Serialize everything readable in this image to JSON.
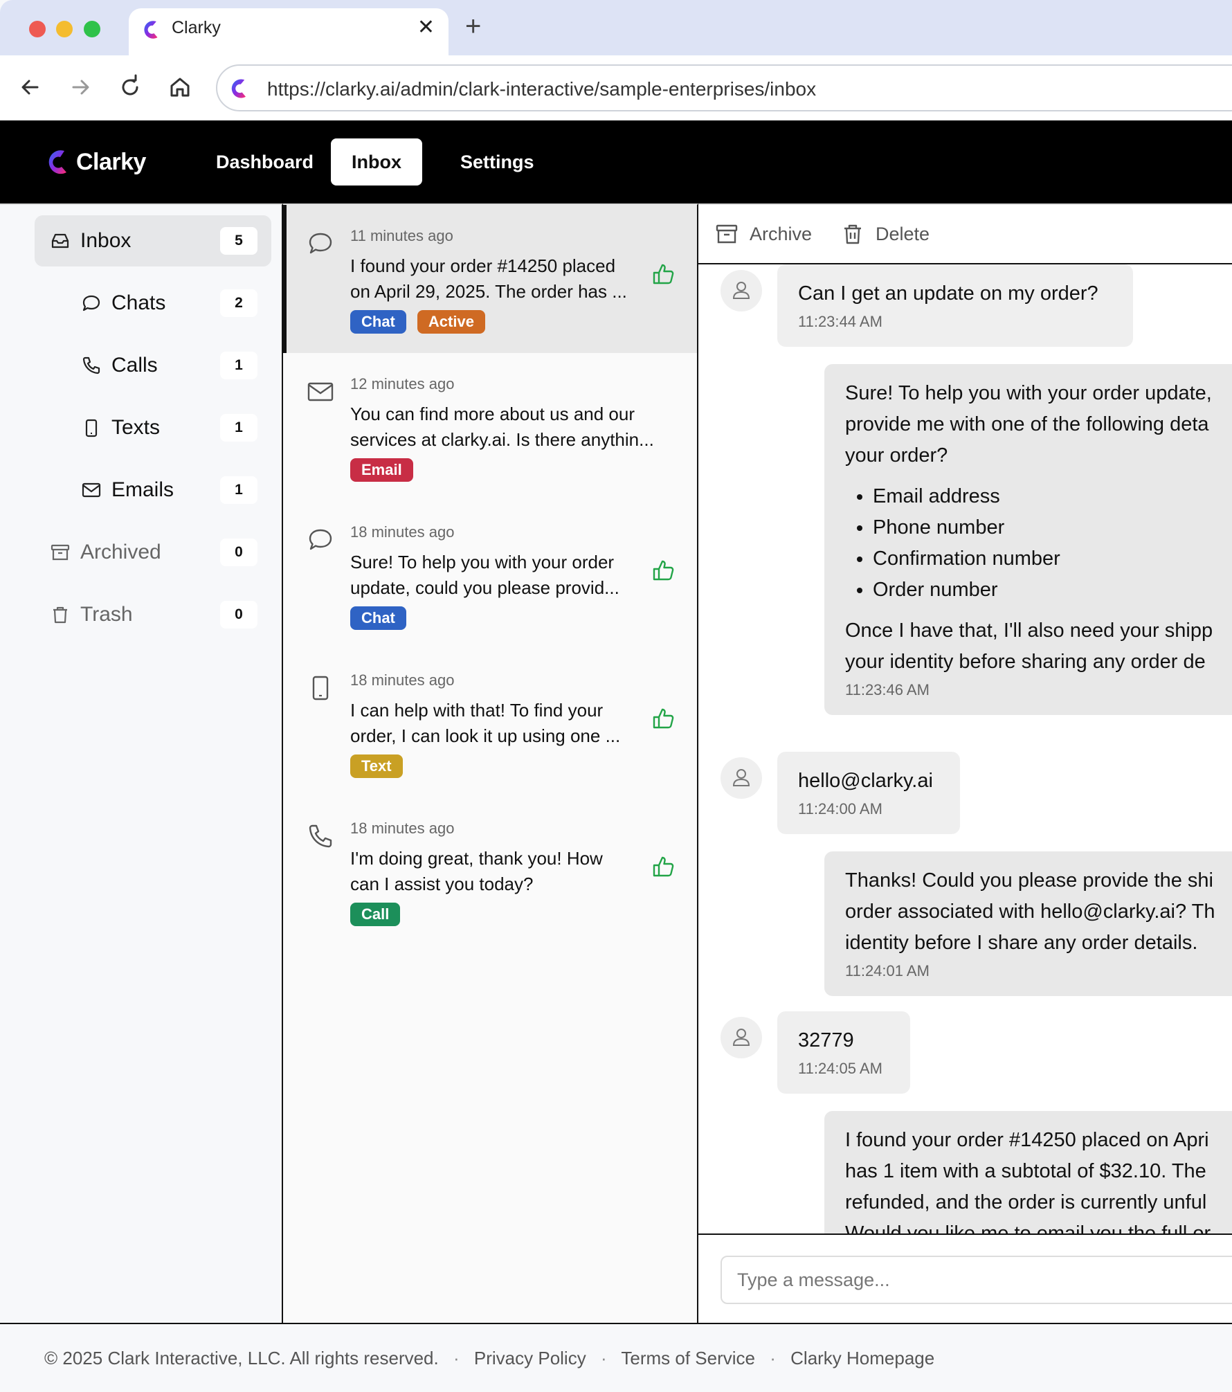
{
  "browser": {
    "tab_title": "Clarky",
    "url": "https://clarky.ai/admin/clark-interactive/sample-enterprises/inbox"
  },
  "header": {
    "brand": "Clarky",
    "nav": [
      "Dashboard",
      "Inbox",
      "Settings"
    ],
    "active_nav": "Inbox"
  },
  "sidebar": {
    "items": [
      {
        "label": "Inbox",
        "count": "5",
        "icon": "inbox-icon"
      },
      {
        "label": "Chats",
        "count": "2",
        "icon": "chat-bubble-icon"
      },
      {
        "label": "Calls",
        "count": "1",
        "icon": "phone-icon"
      },
      {
        "label": "Texts",
        "count": "1",
        "icon": "mobile-icon"
      },
      {
        "label": "Emails",
        "count": "1",
        "icon": "envelope-icon"
      },
      {
        "label": "Archived",
        "count": "0",
        "icon": "archive-icon"
      },
      {
        "label": "Trash",
        "count": "0",
        "icon": "trash-icon"
      }
    ]
  },
  "conversations": [
    {
      "time": "11 minutes ago",
      "lines": [
        "I found your order #14250 placed",
        "on April 29, 2025. The order has ..."
      ],
      "tags": [
        "Chat",
        "Active"
      ],
      "icon": "chat-bubble-icon",
      "thumb": true
    },
    {
      "time": "12 minutes ago",
      "lines": [
        "You can find more about us and our",
        "services at clarky.ai. Is there anythin..."
      ],
      "tags": [
        "Email"
      ],
      "icon": "envelope-icon",
      "thumb": false
    },
    {
      "time": "18 minutes ago",
      "lines": [
        "Sure! To help you with your order",
        "update, could you please provid..."
      ],
      "tags": [
        "Chat"
      ],
      "icon": "chat-bubble-icon",
      "thumb": true
    },
    {
      "time": "18 minutes ago",
      "lines": [
        "I can help with that! To find your",
        "order, I can look it up using one ..."
      ],
      "tags": [
        "Text"
      ],
      "icon": "mobile-icon",
      "thumb": true
    },
    {
      "time": "18 minutes ago",
      "lines": [
        "I'm doing great, thank you! How",
        "can I assist you today?"
      ],
      "tags": [
        "Call"
      ],
      "icon": "phone-icon",
      "thumb": true
    }
  ],
  "detail_toolbar": {
    "archive": "Archive",
    "delete": "Delete"
  },
  "messages": [
    {
      "role": "user",
      "text": "Can I get an update on my order?",
      "time": "11:23:44 AM"
    },
    {
      "role": "bot",
      "lines": [
        "Sure! To help you with your order update,",
        "provide me with one of the following deta",
        "your order?"
      ],
      "bullets": [
        "Email address",
        "Phone number",
        "Confirmation number",
        "Order number"
      ],
      "after": [
        "Once I have that, I'll also need your shipp",
        "your identity before sharing any order de"
      ],
      "time": "11:23:46 AM"
    },
    {
      "role": "user",
      "text": "hello@clarky.ai",
      "time": "11:24:00 AM"
    },
    {
      "role": "bot",
      "lines": [
        "Thanks! Could you please provide the shi",
        "order associated with hello@clarky.ai? Th",
        "identity before I share any order details."
      ],
      "time": "11:24:01 AM"
    },
    {
      "role": "user",
      "text": "32779",
      "time": "11:24:05 AM"
    },
    {
      "role": "bot",
      "lines": [
        "I found your order #14250 placed on Apri",
        "has 1 item with a subtotal of $32.10. The",
        "refunded, and the order is currently unful",
        "Would you like me to email you the full or"
      ]
    }
  ],
  "composer": {
    "placeholder": "Type a message..."
  },
  "footer": {
    "copyright": "© 2025 Clark Interactive, LLC. All rights reserved.",
    "links": [
      "Privacy Policy",
      "Terms of Service",
      "Clarky Homepage"
    ]
  },
  "colors": {
    "chat": "#2f63c4",
    "active": "#cf6a23",
    "email": "#c82d45",
    "text": "#c9a024",
    "call": "#1c8f5a",
    "thumb": "#22a447"
  }
}
